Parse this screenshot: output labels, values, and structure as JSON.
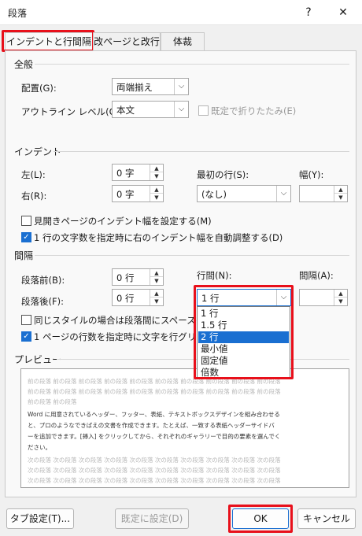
{
  "window": {
    "title": "段落",
    "help": "?",
    "close": "✕"
  },
  "tabs": [
    {
      "label": "インデントと行間隔"
    },
    {
      "label": "改ページと改行"
    },
    {
      "label": "体裁"
    }
  ],
  "general": {
    "heading": "全般",
    "alignment_label": "配置(G):",
    "alignment_value": "両端揃え",
    "outline_label": "アウトライン レベル(O):",
    "outline_value": "本文",
    "collapse_label": "既定で折りたたみ(E)"
  },
  "indent": {
    "heading": "インデント",
    "left_label": "左(L):",
    "left_value": "0 字",
    "right_label": "右(R):",
    "right_value": "0 字",
    "first_line_label": "最初の行(S):",
    "first_line_value": "(なし)",
    "width_label": "幅(Y):",
    "width_value": "",
    "mirror_label": "見開きページのインデント幅を設定する(M)",
    "mirror_checked": false,
    "auto_adjust_label": "1 行の文字数を指定時に右のインデント幅を自動調整する(D)",
    "auto_adjust_checked": true
  },
  "spacing": {
    "heading": "間隔",
    "before_label": "段落前(B):",
    "before_value": "0 行",
    "after_label": "段落後(F):",
    "after_value": "0 行",
    "line_spacing_label": "行間(N):",
    "line_spacing_value": "1 行",
    "at_label": "間隔(A):",
    "at_value": "",
    "no_space_same_style_label": "同じスタイルの場合は段落間にスペースを追",
    "no_space_checked": false,
    "snap_grid_label": "1 ページの行数を指定時に文字を行グリッド",
    "snap_checked": true,
    "line_spacing_options": [
      "1 行",
      "1.5 行",
      "2 行",
      "最小値",
      "固定値",
      "倍数"
    ],
    "selected_option": "2 行"
  },
  "preview": {
    "heading": "プレビュー",
    "prev_para": "前の段落 前の段落 前の段落 前の段落 前の段落 前の段落 前の段落 前の段落 前の段落 前の段落",
    "prev_para_short": "前の段落 前の段落",
    "sample_1": "Word に用意されているヘッダー、フッター、表紙、テキストボックスデザインを組み合わせる",
    "sample_2": "と、プロのようなできばえの文書を作成できます。たとえば、一致する表紙ヘッダーサイドバ",
    "sample_3": "ーを追加できます。[挿入] をクリックしてから、それぞれのギャラリーで目的の要素を選んでく",
    "sample_4": "ださい。",
    "next_para": "次の段落 次の段落 次の段落 次の段落 次の段落 次の段落 次の段落 次の段落 次の段落 次の段落"
  },
  "buttons": {
    "tabs_label": "タブ設定(T)...",
    "default_label": "既定に設定(D)",
    "ok_label": "OK",
    "cancel_label": "キャンセル"
  },
  "colors": {
    "highlight": "#e8101b",
    "accent": "#1a6fd1"
  }
}
